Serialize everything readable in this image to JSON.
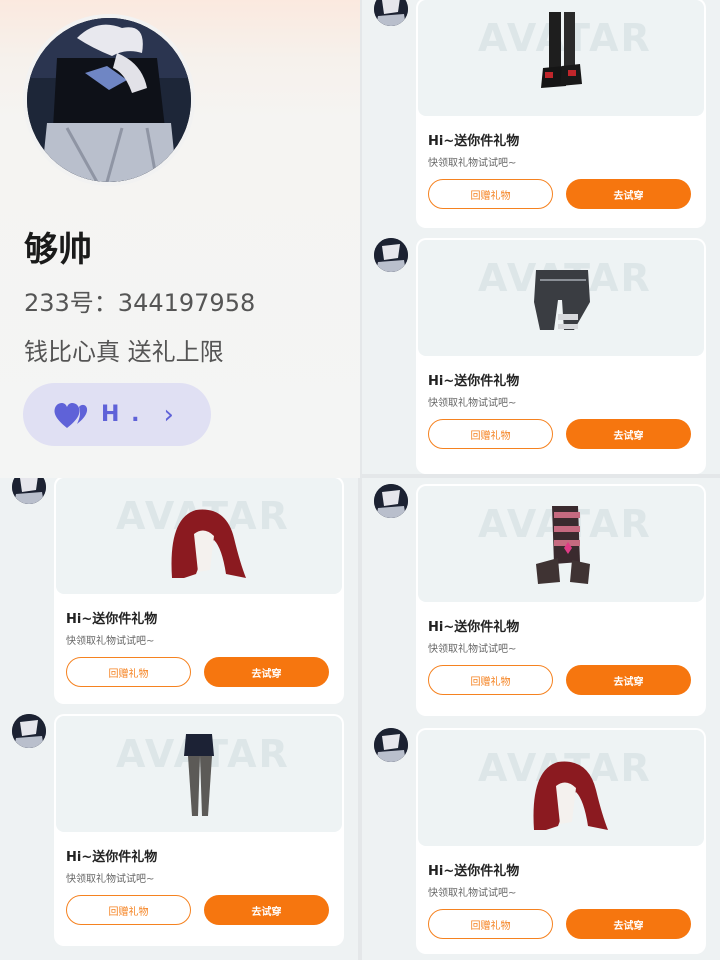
{
  "profile": {
    "name": "够帅",
    "uid": "233号：344197958",
    "status": "钱比心真 送礼上限",
    "fan_badge": {
      "text": "H .",
      "chevron": "›"
    }
  },
  "watermark": "AVATAR",
  "gifts": [
    {
      "title": "Hi~送你件礼物",
      "subtitle": "快领取礼物试试吧~",
      "return_label": "回赠礼物",
      "try_label": "去试穿",
      "item_icon": "boots-icon"
    },
    {
      "title": "Hi~送你件礼物",
      "subtitle": "快领取礼物试试吧~",
      "return_label": "回赠礼物",
      "try_label": "去试穿",
      "item_icon": "shorts-icon"
    },
    {
      "title": "Hi~送你件礼物",
      "subtitle": "快领取礼物试试吧~",
      "return_label": "回赠礼物",
      "try_label": "去试穿",
      "item_icon": "hair-icon"
    },
    {
      "title": "Hi~送你件礼物",
      "subtitle": "快领取礼物试试吧~",
      "return_label": "回赠礼物",
      "try_label": "去试穿",
      "item_icon": "leg-warmers-icon"
    },
    {
      "title": "Hi~送你件礼物",
      "subtitle": "快领取礼物试试吧~",
      "return_label": "回赠礼物",
      "try_label": "去试穿",
      "item_icon": "skirt-tights-icon"
    },
    {
      "title": "Hi~送你件礼物",
      "subtitle": "快领取礼物试试吧~",
      "return_label": "回赠礼物",
      "try_label": "去试穿",
      "item_icon": "hair-icon"
    }
  ],
  "colors": {
    "accent": "#f6760f",
    "badge_bg": "#e0e0f3",
    "badge_fg": "#5f62d8"
  }
}
